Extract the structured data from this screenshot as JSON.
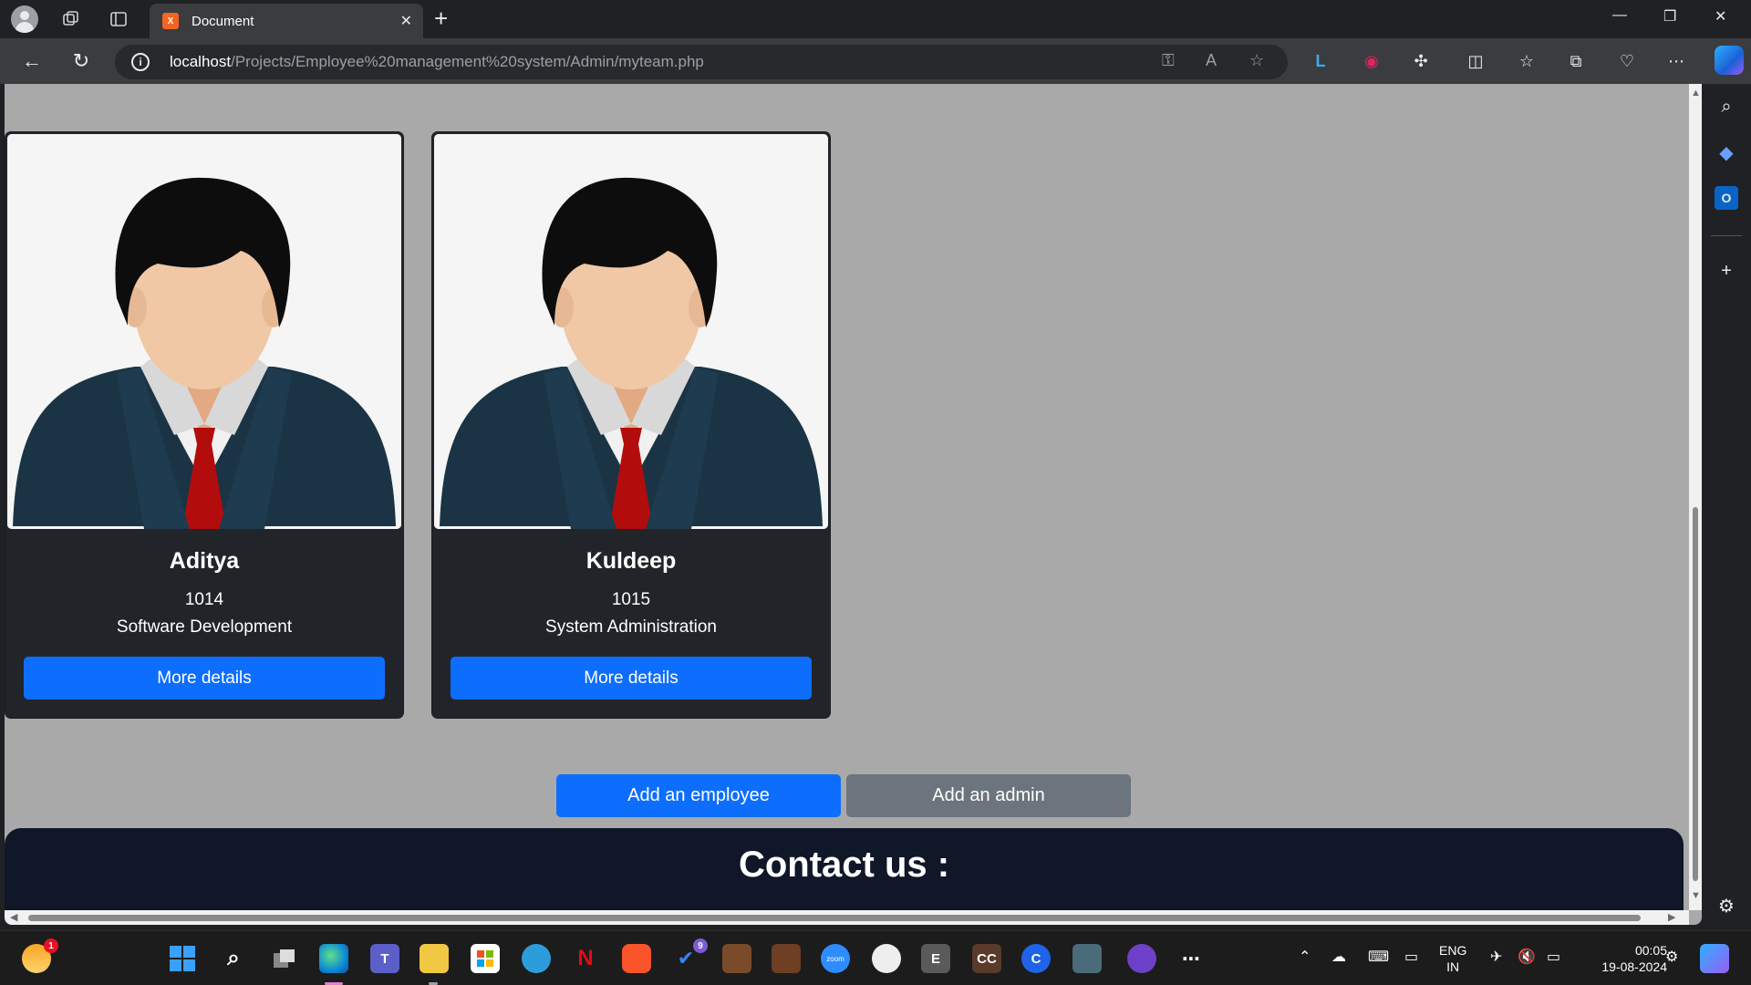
{
  "browser": {
    "tab_title": "Document",
    "tab_favicon_text": "X",
    "url_host": "localhost",
    "url_path": "/Projects/Employee%20management%20system/Admin/myteam.php"
  },
  "page": {
    "employees": [
      {
        "name": "Aditya",
        "id": "1014",
        "department": "Software Development",
        "button_label": "More details"
      },
      {
        "name": "Kuldeep",
        "id": "1015",
        "department": "System Administration",
        "button_label": "More details"
      }
    ],
    "add_employee_label": "Add an employee",
    "add_admin_label": "Add an admin",
    "footer_title": "Contact us :"
  },
  "taskbar": {
    "weather_badge": "1",
    "todo_badge": "9",
    "netflix_label": "N",
    "zoom_label": "zoom",
    "e_label": "E",
    "cc_label": "CC",
    "c_label": "C",
    "lang_line1": "ENG",
    "lang_line2": "IN",
    "time": "00:05",
    "date": "19-08-2024"
  },
  "colors": {
    "primary": "#0d6efd",
    "secondary": "#6c757d",
    "card_bg": "#212529",
    "page_bg": "#a9a9a9",
    "footer_bg": "#0f1729"
  }
}
